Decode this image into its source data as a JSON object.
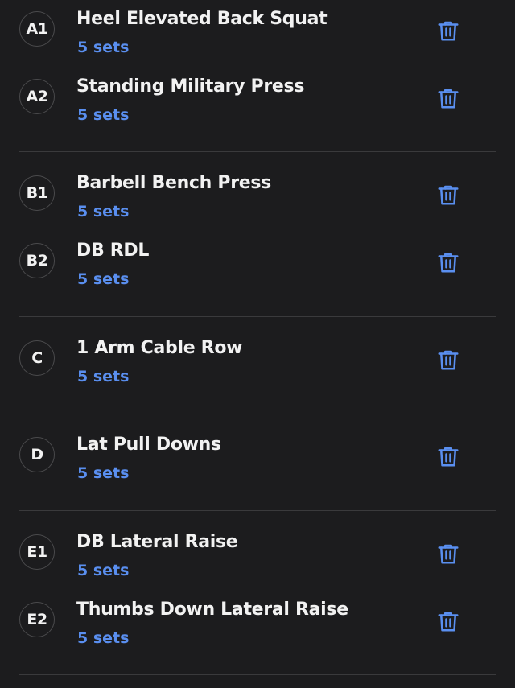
{
  "colors": {
    "background": "#1c1c1e",
    "text": "#f2f2f2",
    "accent": "#5a8ff0",
    "divider": "#3a3a3c"
  },
  "exercises": [
    {
      "label": "A1",
      "name": "Heel Elevated Back Squat",
      "sets": "5 sets"
    },
    {
      "label": "A2",
      "name": "Standing Military Press",
      "sets": "5 sets"
    },
    {
      "label": "B1",
      "name": "Barbell Bench Press",
      "sets": "5 sets"
    },
    {
      "label": "B2",
      "name": "DB RDL",
      "sets": "5 sets"
    },
    {
      "label": "C",
      "name": "1 Arm Cable Row",
      "sets": "5 sets"
    },
    {
      "label": "D",
      "name": "Lat Pull Downs",
      "sets": "5 sets"
    },
    {
      "label": "E1",
      "name": "DB Lateral Raise",
      "sets": "5 sets"
    },
    {
      "label": "E2",
      "name": "Thumbs Down Lateral Raise",
      "sets": "5 sets"
    }
  ],
  "icons": {
    "delete": "trash-icon"
  }
}
